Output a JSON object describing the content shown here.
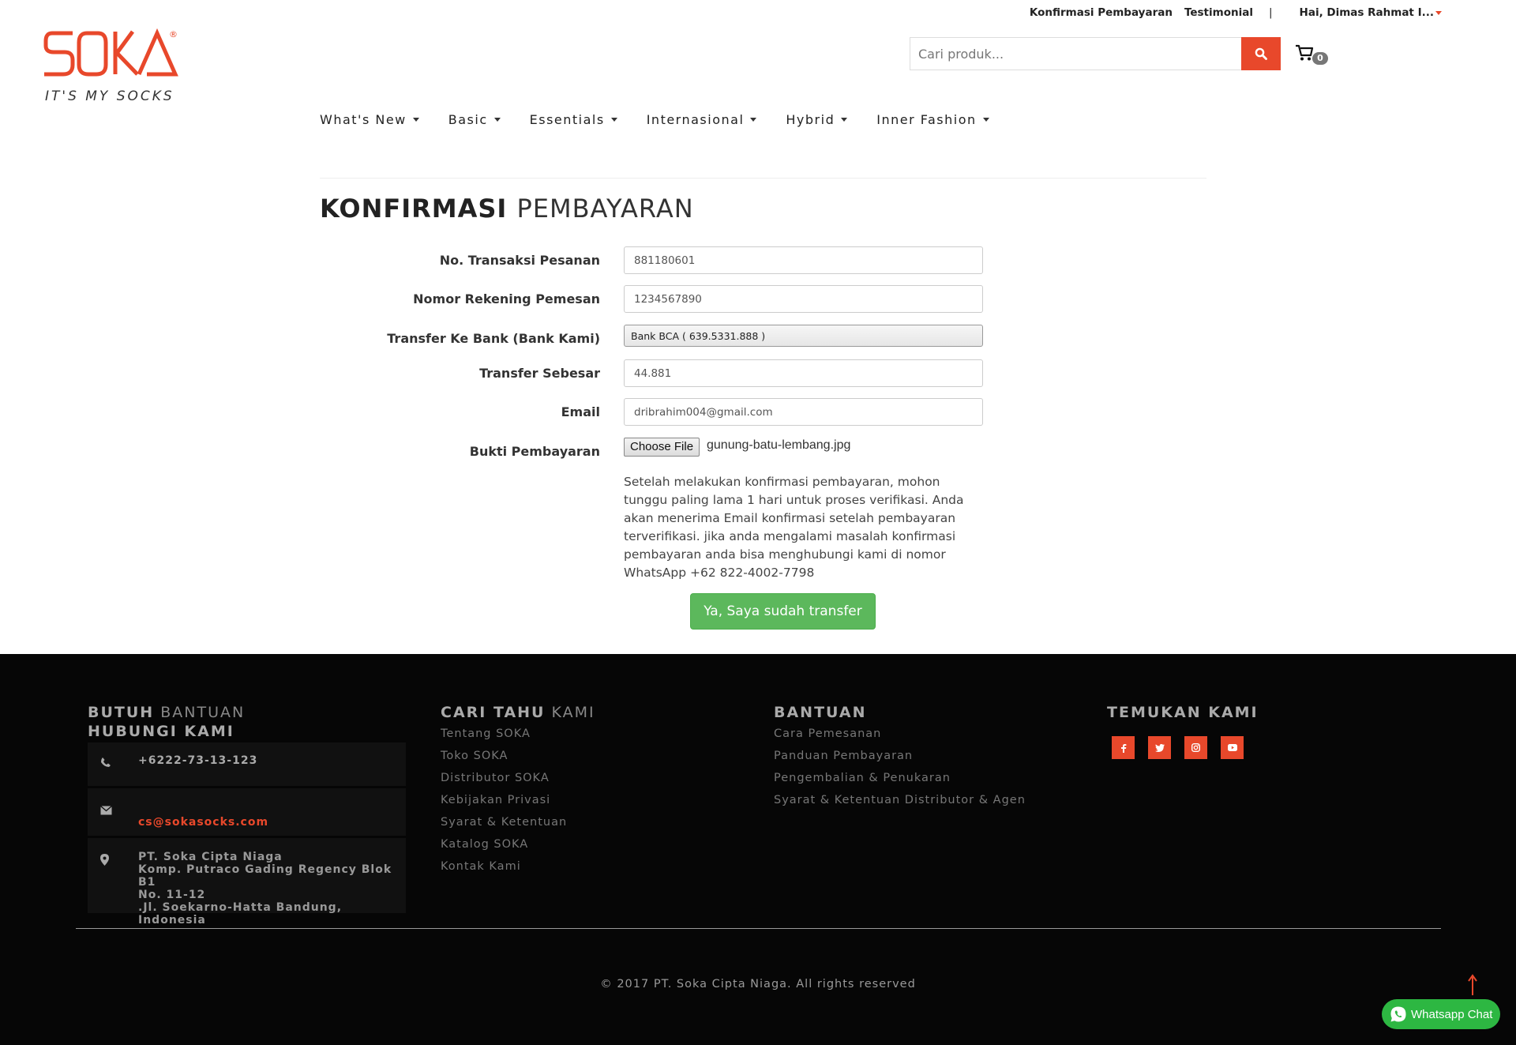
{
  "header": {
    "top_links": {
      "payment_confirmation": "Konfirmasi Pembayaran",
      "testimonial": "Testimonial",
      "separator": "|",
      "user_greeting": "Hai, Dimas Rahmat I..."
    },
    "logo": {
      "brand": "SOKA",
      "tagline": "IT'S MY SOCKS",
      "registered": "®"
    },
    "search": {
      "placeholder": "Cari produk..."
    },
    "cart": {
      "count": "0"
    },
    "nav": [
      "What's New",
      "Basic",
      "Essentials",
      "Internasional",
      "Hybrid",
      "Inner Fashion"
    ]
  },
  "page": {
    "title_bold": "KONFIRMASI",
    "title_light": "PEMBAYARAN"
  },
  "form": {
    "transaction_label": "No. Transaksi Pesanan",
    "transaction_value": "881180601",
    "account_label": "Nomor Rekening Pemesan",
    "account_value": "1234567890",
    "bank_label": "Transfer Ke Bank (Bank Kami)",
    "bank_value": "Bank BCA ( 639.5331.888 )",
    "amount_label": "Transfer Sebesar",
    "amount_value": "44.881",
    "email_label": "Email",
    "email_value": "dribrahim004@gmail.com",
    "proof_label": "Bukti Pembayaran",
    "file_button": "Choose File",
    "file_name": "gunung-batu-lembang.jpg",
    "note": "Setelah melakukan konfirmasi pembayaran, mohon tunggu paling lama 1 hari untuk proses verifikasi. Anda akan menerima Email konfirmasi setelah pembayaran terverifikasi. jika anda mengalami masalah konfirmasi pembayaran anda bisa menghubungi kami di nomor WhatsApp +62 822-4002-7798",
    "submit_label": "Ya, Saya sudah transfer"
  },
  "footer": {
    "help": {
      "title_bold": "BUTUH",
      "title_light": "BANTUAN",
      "subtitle": "HUBUNGI KAMI",
      "phone": "+6222-73-13-123",
      "email": "cs@sokasocks.com",
      "address_lines": [
        "PT. Soka Cipta Niaga",
        "Komp. Putraco Gading Regency Blok B1",
        "No. 11-12",
        ".Jl. Soekarno-Hatta Bandung, Indonesia"
      ]
    },
    "about": {
      "title_bold": "CARI TAHU",
      "title_light": "KAMI",
      "links": [
        "Tentang SOKA",
        "Toko SOKA",
        "Distributor SOKA",
        "Kebijakan Privasi",
        "Syarat & Ketentuan",
        "Katalog SOKA",
        "Kontak Kami"
      ]
    },
    "support": {
      "title": "BANTUAN",
      "links": [
        "Cara Pemesanan",
        "Panduan Pembayaran",
        "Pengembalian & Penukaran",
        "Syarat & Ketentuan Distributor & Agen"
      ]
    },
    "social": {
      "title": "TEMUKAN KAMI",
      "icons": [
        "facebook-icon",
        "twitter-icon",
        "instagram-icon",
        "youtube-icon"
      ]
    },
    "copyright": "© 2017 PT. Soka Cipta Niaga. All rights reserved",
    "whatsapp_label": "Whatsapp Chat"
  },
  "colors": {
    "accent": "#e8482b",
    "success": "#5cb85c",
    "footer_bg": "#060606",
    "whatsapp": "#2db742"
  }
}
